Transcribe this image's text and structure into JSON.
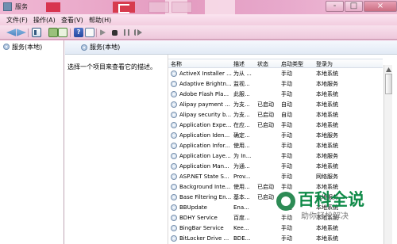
{
  "window": {
    "title": "服务"
  },
  "menu": {
    "items": [
      "文件(F)",
      "操作(A)",
      "查看(V)",
      "帮助(H)"
    ]
  },
  "tree": {
    "root": "服务(本地)"
  },
  "main": {
    "heading": "服务(本地)",
    "description_prompt": "选择一个项目来查看它的描述。"
  },
  "table": {
    "headers": [
      "名称",
      "描述",
      "状态",
      "启动类型",
      "登录为"
    ],
    "rows": [
      [
        "ActiveX Installer ...",
        "为从 ...",
        "",
        "手动",
        "本地系统"
      ],
      [
        "Adaptive Brightn...",
        "监视...",
        "",
        "手动",
        "本地服务"
      ],
      [
        "Adobe Flash Pla...",
        "此服...",
        "",
        "手动",
        "本地系统"
      ],
      [
        "Alipay payment ...",
        "为支...",
        "已启动",
        "自动",
        "本地系统"
      ],
      [
        "Alipay security b...",
        "为支...",
        "已启动",
        "自动",
        "本地系统"
      ],
      [
        "Application Expe...",
        "在应...",
        "已启动",
        "手动",
        "本地系统"
      ],
      [
        "Application Iden...",
        "确定...",
        "",
        "手动",
        "本地服务"
      ],
      [
        "Application Infor...",
        "使用...",
        "",
        "手动",
        "本地系统"
      ],
      [
        "Application Laye...",
        "为 In...",
        "",
        "手动",
        "本地服务"
      ],
      [
        "Application Man...",
        "为通...",
        "",
        "手动",
        "本地系统"
      ],
      [
        "ASP.NET State S...",
        "Prov...",
        "",
        "手动",
        "网络服务"
      ],
      [
        "Background Inte...",
        "使用...",
        "已启动",
        "手动",
        "本地系统"
      ],
      [
        "Base Filtering En...",
        "基本...",
        "已启动",
        "自动",
        "本地服务"
      ],
      [
        "BBUpdate",
        "Ena...",
        "",
        "手动",
        "本地系统"
      ],
      [
        "BDHY Service",
        "百度...",
        "",
        "手动",
        "本地系统"
      ],
      [
        "BingBar Service",
        "Kee...",
        "",
        "手动",
        "本地系统"
      ],
      [
        "BitLocker Drive ...",
        "BDE...",
        "",
        "手动",
        "本地系统"
      ]
    ]
  },
  "watermark": {
    "title": "百科全说",
    "subtitle": "助你轻松解决"
  },
  "icons": {
    "window": "gear-icon",
    "tree": "gear-icon",
    "service": "gear-icon"
  }
}
